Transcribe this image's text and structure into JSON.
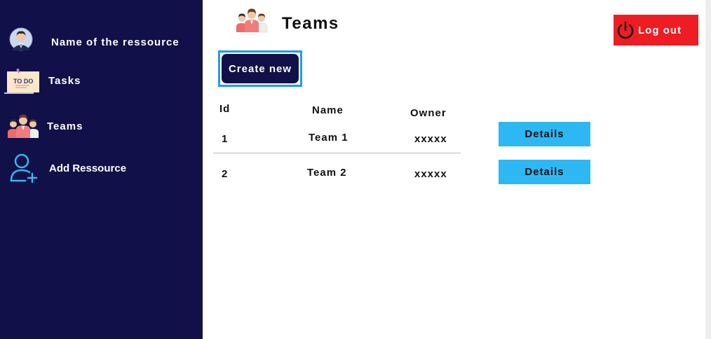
{
  "sidebar": {
    "profile_label": "Name of the ressource",
    "tasks_label": "Tasks",
    "tasks_icon_text": "TO DO",
    "teams_label": "Teams",
    "add_label": "Add Ressource"
  },
  "header": {
    "title": "Teams",
    "create_label": "Create new",
    "logout_label": "Log out"
  },
  "table": {
    "headers": {
      "id": "Id",
      "name": "Name",
      "owner": "Owner"
    },
    "rows": [
      {
        "id": "1",
        "name": "Team 1",
        "owner": "xxxxx",
        "action": "Details"
      },
      {
        "id": "2",
        "name": "Team 2",
        "owner": "xxxxx",
        "action": "Details"
      }
    ]
  },
  "colors": {
    "sidebar_bg": "#111048",
    "logout_bg": "#ee1d23",
    "details_bg": "#2db8f3",
    "create_border": "#1e9cf0"
  },
  "icons": {
    "profile": "avatar-icon",
    "tasks": "todo-note-icon",
    "teams": "team-people-icon",
    "add": "add-user-icon",
    "logout": "power-icon"
  }
}
